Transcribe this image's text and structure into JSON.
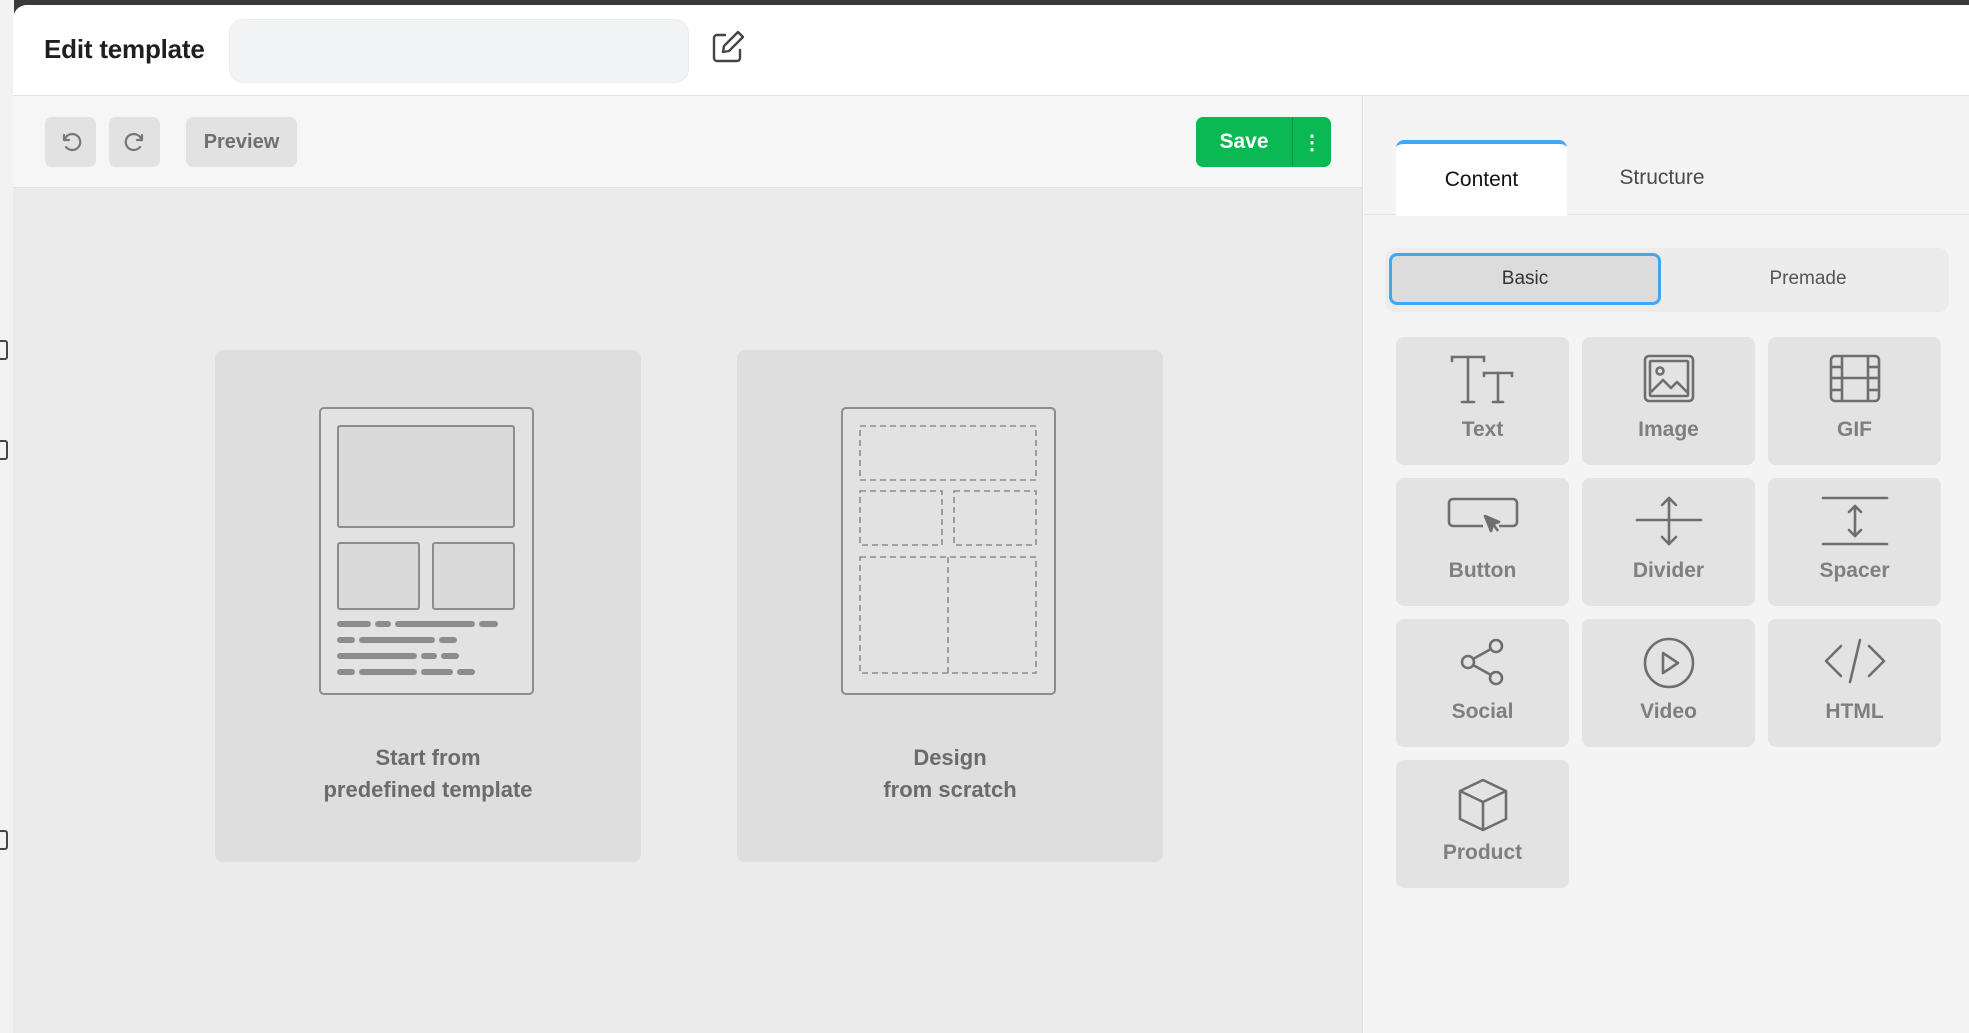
{
  "header": {
    "title": "Edit template",
    "name_value": "",
    "name_placeholder": ""
  },
  "toolbar": {
    "preview_label": "Preview",
    "save_label": "Save",
    "more_label": "⋮"
  },
  "cards": [
    {
      "line1": "Start from",
      "line2": "predefined template"
    },
    {
      "line1": "Design",
      "line2": "from scratch"
    }
  ],
  "panel": {
    "tabs": [
      "Content",
      "Structure"
    ],
    "active_tab": "Content",
    "segments": [
      "Basic",
      "Premade"
    ],
    "active_segment": "Basic",
    "blocks": [
      {
        "label": "Text",
        "icon": "text-icon"
      },
      {
        "label": "Image",
        "icon": "image-icon"
      },
      {
        "label": "GIF",
        "icon": "gif-icon"
      },
      {
        "label": "Button",
        "icon": "button-icon"
      },
      {
        "label": "Divider",
        "icon": "divider-icon"
      },
      {
        "label": "Spacer",
        "icon": "spacer-icon"
      },
      {
        "label": "Social",
        "icon": "social-icon"
      },
      {
        "label": "Video",
        "icon": "video-icon"
      },
      {
        "label": "HTML",
        "icon": "html-icon"
      },
      {
        "label": "Product",
        "icon": "product-icon"
      }
    ]
  },
  "colors": {
    "accent_blue": "#3ea8f5",
    "save_green": "#0bb954"
  }
}
